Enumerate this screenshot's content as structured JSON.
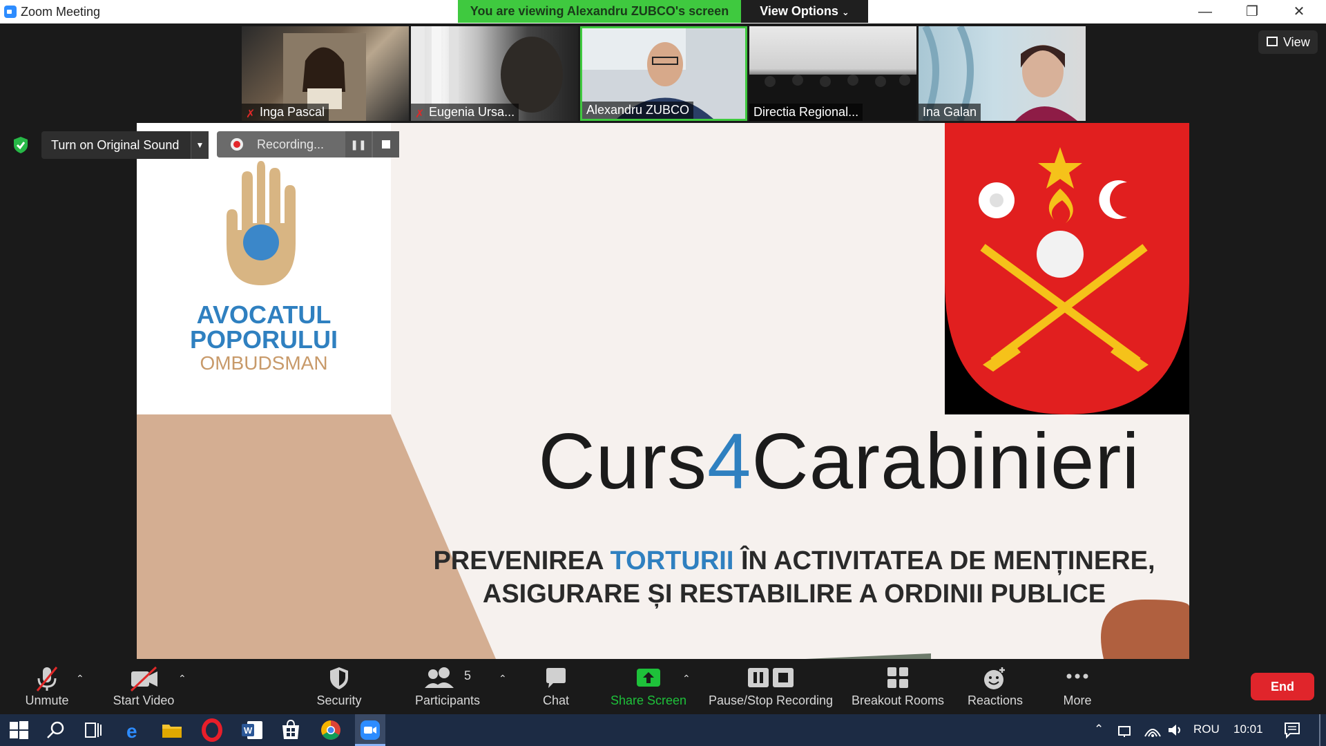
{
  "window": {
    "title": "Zoom Meeting",
    "viewing_banner": "You are viewing Alexandru ZUBCO's screen",
    "view_options": "View Options"
  },
  "participants": [
    {
      "name": "Inga Pascal",
      "muted": true
    },
    {
      "name": "Eugenia Ursa...",
      "muted": true
    },
    {
      "name": "Alexandru ZUBCO",
      "muted": false
    },
    {
      "name": "Directia Regional...",
      "muted": false
    },
    {
      "name": "Ina Galan",
      "muted": false
    }
  ],
  "view_button": "View",
  "original_sound": "Turn on Original Sound",
  "recording": "Recording...",
  "slide": {
    "logo_line1": "AVOCATUL",
    "logo_line2": "POPORULUI",
    "logo_line3": "OMBUDSMAN",
    "title_part1": "Curs",
    "title_num": "4",
    "title_part2": "Carabinieri",
    "sub_part1": "PREVENIREA ",
    "sub_highlight": "TORTURII",
    "sub_part2": " ÎN ACTIVITATEA DE MENȚINERE,",
    "sub_line2": "ASIGURARE ȘI RESTABILIRE A ORDINII PUBLICE"
  },
  "toolbar": {
    "unmute": "Unmute",
    "start_video": "Start Video",
    "security": "Security",
    "participants": "Participants",
    "participants_count": "5",
    "chat": "Chat",
    "share_screen": "Share Screen",
    "pause_stop": "Pause/Stop Recording",
    "breakout": "Breakout Rooms",
    "reactions": "Reactions",
    "more": "More",
    "end": "End"
  },
  "taskbar": {
    "language": "ROU",
    "time": "10:01"
  },
  "colors": {
    "banner_green": "#3fc93f",
    "end_red": "#e0252b",
    "share_green": "#1ec13a",
    "accent_blue": "#2f80c0"
  }
}
